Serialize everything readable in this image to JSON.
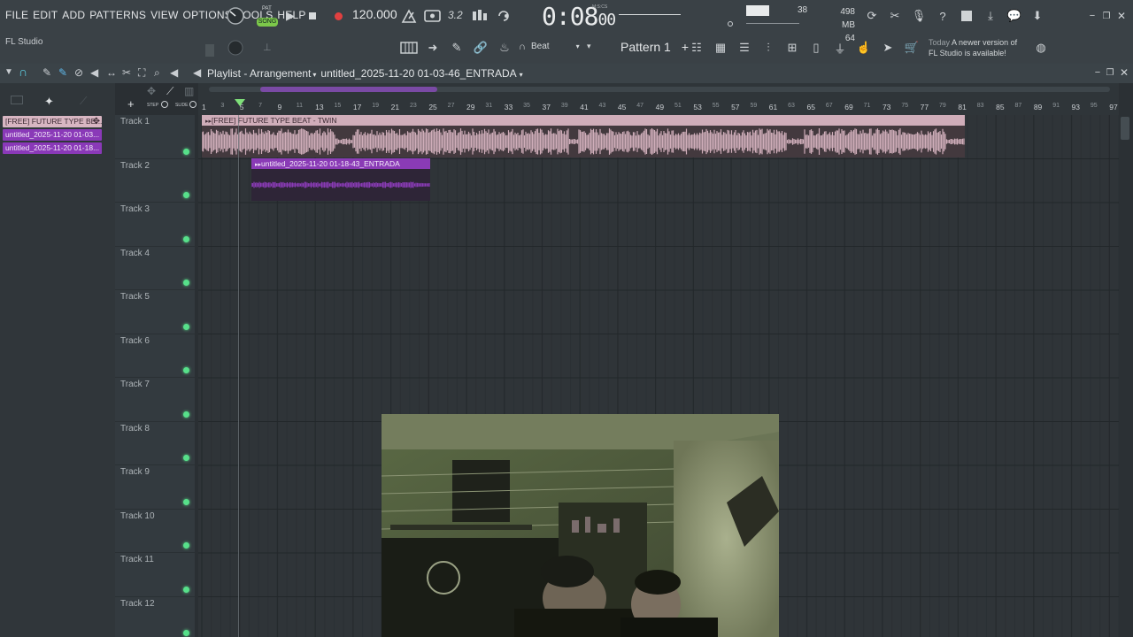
{
  "menu": {
    "file": "FILE",
    "edit": "EDIT",
    "add": "ADD",
    "patterns": "PATTERNS",
    "view": "VIEW",
    "options": "OPTIONS",
    "tools": "TOOLS",
    "help": "HELP"
  },
  "app_title": "FL Studio",
  "transport": {
    "mode_pat": "PAT",
    "mode_song": "SONG",
    "bpm": "120.000",
    "time": "0:08",
    "time_frac": "00",
    "time_label": "M:S:CS",
    "snap_value": "3.2"
  },
  "monitor": {
    "cpu_voices": "38",
    "memory": "498 MB",
    "polyphony": "64"
  },
  "toolbar": {
    "snap_label": "Beat",
    "pattern_label": "Pattern 1",
    "pattern_add": "+"
  },
  "news": {
    "when": "Today",
    "message_line1": "A newer version of",
    "message_line2": "FL Studio is available!"
  },
  "playlist": {
    "title": "Playlist - Arrangement",
    "separator": "▸",
    "project": "untitled_2025-11-20 01-03-46_ENTRADA",
    "step_label": "STEP",
    "slide_label": "SLIDE"
  },
  "picker": {
    "clips": [
      {
        "label": "[FREE] FUTURE TYPE BE...",
        "type": "audio1"
      },
      {
        "label": "untitled_2025-11-20 01-03...",
        "type": "audio2"
      },
      {
        "label": "untitled_2025-11-20 01-18...",
        "type": "audio2"
      }
    ]
  },
  "ruler_marks": [
    "1",
    "3",
    "5",
    "7",
    "9",
    "11",
    "13",
    "15",
    "17",
    "19",
    "21",
    "23",
    "25",
    "27",
    "29",
    "31",
    "33",
    "35",
    "37",
    "39",
    "41",
    "43",
    "45",
    "47",
    "49",
    "51",
    "53",
    "55",
    "57",
    "59",
    "61",
    "63",
    "65",
    "67",
    "69",
    "71",
    "73",
    "75",
    "77",
    "79",
    "81",
    "83",
    "85",
    "87",
    "89",
    "91",
    "93",
    "95",
    "97"
  ],
  "tracks": [
    {
      "name": "Track 1"
    },
    {
      "name": "Track 2"
    },
    {
      "name": "Track 3"
    },
    {
      "name": "Track 4"
    },
    {
      "name": "Track 5"
    },
    {
      "name": "Track 6"
    },
    {
      "name": "Track 7"
    },
    {
      "name": "Track 8"
    },
    {
      "name": "Track 9"
    },
    {
      "name": "Track 10"
    },
    {
      "name": "Track 11"
    },
    {
      "name": "Track 12"
    }
  ],
  "clips": {
    "clip1_title": "[FREE] FUTURE TYPE BEAT - TWIN",
    "clip2_title": "untitled_2025-11-20 01-18-43_ENTRADA"
  },
  "colors": {
    "audio_clip_1": "#cfadb9",
    "audio_clip_2": "#8a3bb6",
    "track_led": "#57e08a",
    "song_mode": "#7cc84a",
    "record": "#e04040"
  }
}
